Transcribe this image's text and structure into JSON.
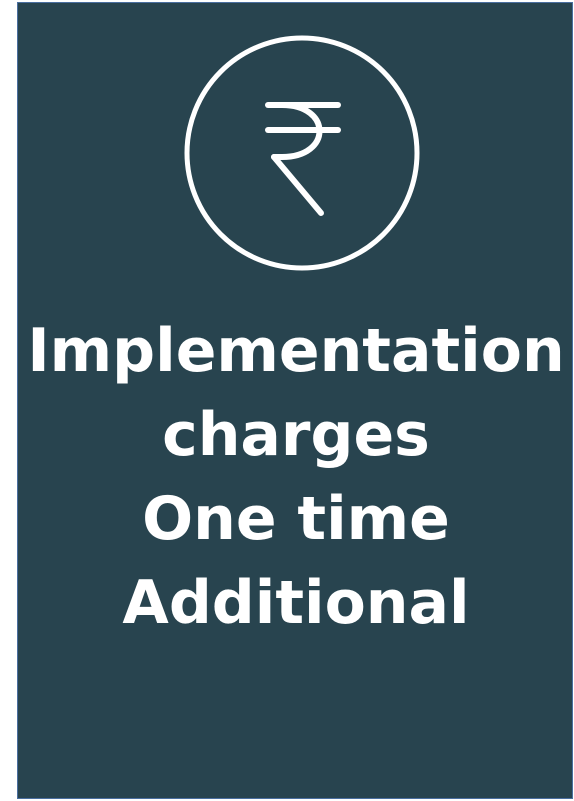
{
  "card": {
    "background": "#28444f",
    "border": "#4a6fa0",
    "icon": "rupee-icon",
    "lines": [
      "Implementation",
      "charges",
      "One time",
      "Additional"
    ]
  }
}
